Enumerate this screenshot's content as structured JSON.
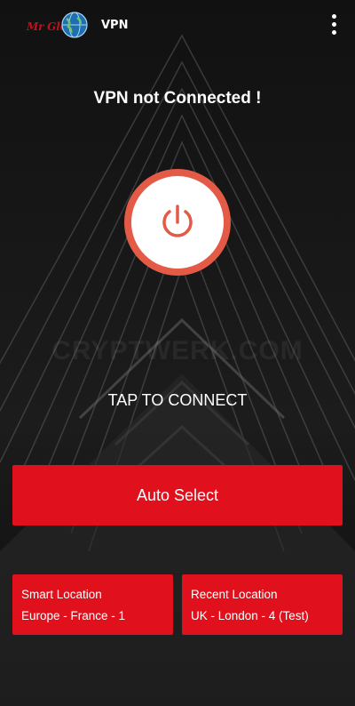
{
  "header": {
    "logo_text": "Mr Globe VPN",
    "logo_brand": "Mr Globe",
    "logo_suffix": "VPN",
    "menu_icon": "more-vertical-icon"
  },
  "status": {
    "text": "VPN not Connected !"
  },
  "power": {
    "icon": "power-icon",
    "ring_color": "#e35a47"
  },
  "watermark": {
    "text": "CRYPTWERK.COM"
  },
  "action": {
    "tap_label": "TAP TO CONNECT",
    "auto_select_label": "Auto Select"
  },
  "locations": {
    "smart": {
      "title": "Smart Location",
      "value": "Europe - France - 1"
    },
    "recent": {
      "title": "Recent Location",
      "value": "UK - London - 4 (Test)"
    }
  },
  "colors": {
    "accent": "#e0111d",
    "background": "#0d0d0d"
  }
}
